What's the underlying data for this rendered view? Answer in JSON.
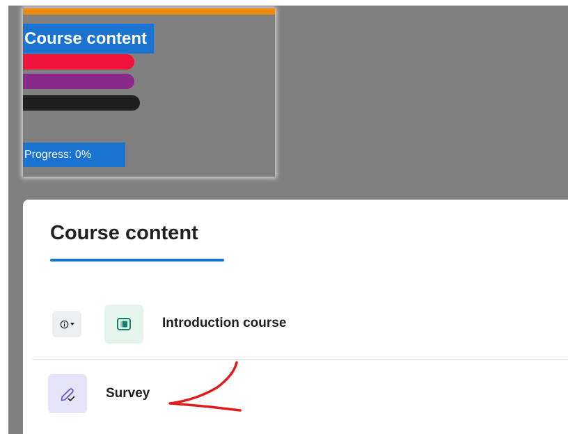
{
  "colors": {
    "backdrop": "#808080",
    "accent_orange": "#ef8c0d",
    "brand_blue": "#1a73d1",
    "bar_red": "#f0143c",
    "bar_purple": "#8a2a8a",
    "bar_black": "#1f1f1f",
    "annotation_red": "#e01b1b",
    "page_icon_bg": "#e6f4ee",
    "page_icon_fg": "#158069",
    "survey_icon_bg": "#e5e3f7",
    "survey_icon_fg": "#5b4fc9"
  },
  "course_card": {
    "title": "Course content",
    "progress_label": "Progress: 0%"
  },
  "panel": {
    "heading": "Course content",
    "activities": [
      {
        "name": "Introduction course",
        "icon": "page-icon",
        "has_info_button": true,
        "info_icon": "info-icon"
      },
      {
        "name": "Survey",
        "icon": "survey-pencil-icon",
        "has_info_button": false
      }
    ]
  }
}
